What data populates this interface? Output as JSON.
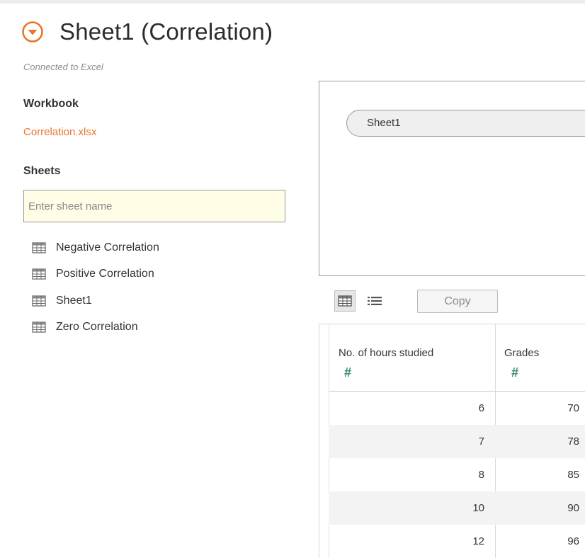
{
  "header": {
    "title": "Sheet1 (Correlation)",
    "subtitle": "Connected to Excel"
  },
  "sidebar": {
    "workbook_heading": "Workbook",
    "workbook_file": "Correlation.xlsx",
    "sheets_heading": "Sheets",
    "search_placeholder": "Enter sheet name",
    "sheets": [
      {
        "label": "Negative Correlation",
        "icon": "table-grid-icon"
      },
      {
        "label": "Positive Correlation",
        "icon": "table-grid-icon"
      },
      {
        "label": "Sheet1",
        "icon": "table-grid-icon"
      },
      {
        "label": "Zero Correlation",
        "icon": "table-grid-icon"
      }
    ]
  },
  "canvas": {
    "selected_sheet": "Sheet1"
  },
  "toolbar": {
    "grid_view_icon": "grid-view-icon",
    "list_view_icon": "list-view-icon",
    "copy_label": "Copy"
  },
  "table": {
    "columns": [
      {
        "label": "No. of hours studied",
        "type_icon": "#"
      },
      {
        "label": "Grades",
        "type_icon": "#"
      }
    ],
    "rows": [
      [
        "6",
        "70"
      ],
      [
        "7",
        "78"
      ],
      [
        "8",
        "85"
      ],
      [
        "10",
        "90"
      ],
      [
        "12",
        "96"
      ]
    ]
  },
  "colors": {
    "accent_orange": "#e8762c",
    "numeric_green": "#2e8a60",
    "search_background": "#fffde6"
  }
}
